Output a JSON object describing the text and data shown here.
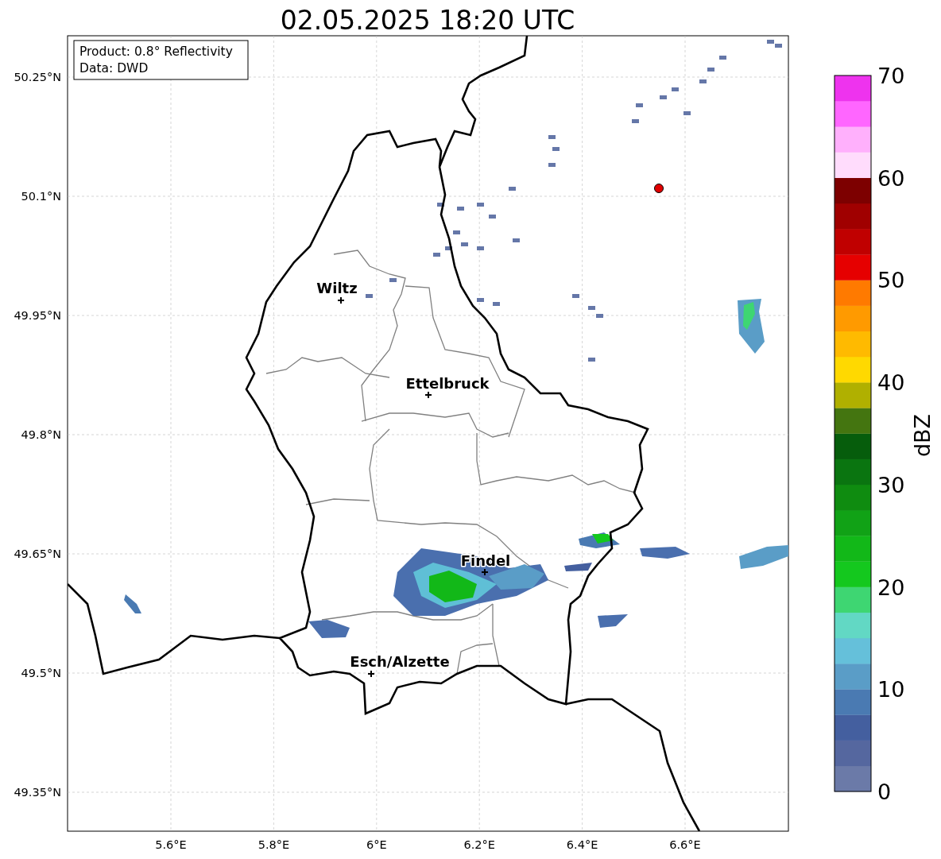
{
  "title": "02.05.2025 18:20 UTC",
  "info_box": [
    "Product: 0.8° Reflectivity",
    "Data: DWD"
  ],
  "lat_labels": [
    "50.25°N",
    "50.1°N",
    "49.95°N",
    "49.8°N",
    "49.65°N",
    "49.5°N",
    "49.35°N"
  ],
  "lon_labels": [
    "5.6°E",
    "5.8°E",
    "6°E",
    "6.2°E",
    "6.4°E",
    "6.6°E"
  ],
  "cities": [
    {
      "name": "Wiltz"
    },
    {
      "name": "Ettelbruck"
    },
    {
      "name": "Findel"
    },
    {
      "name": "Esch/Alzette"
    }
  ],
  "colorbar": {
    "label": "dBZ",
    "ticks": [
      "70",
      "60",
      "50",
      "40",
      "30",
      "20",
      "10",
      "0"
    ],
    "bins": [
      {
        "color": "#6b7aa8"
      },
      {
        "color": "#55679f"
      },
      {
        "color": "#445f9f"
      },
      {
        "color": "#4a7ab2"
      },
      {
        "color": "#5a9dc7"
      },
      {
        "color": "#65c0da"
      },
      {
        "color": "#62d8c4"
      },
      {
        "color": "#3ed672"
      },
      {
        "color": "#14c81e"
      },
      {
        "color": "#12b818"
      },
      {
        "color": "#11a216"
      },
      {
        "color": "#0f8c10"
      },
      {
        "color": "#0a7510"
      },
      {
        "color": "#065d0c"
      },
      {
        "color": "#447510"
      },
      {
        "color": "#b0b000"
      },
      {
        "color": "#ffd900"
      },
      {
        "color": "#ffba00"
      },
      {
        "color": "#ff9a00"
      },
      {
        "color": "#ff7a00"
      },
      {
        "color": "#e60000"
      },
      {
        "color": "#c00000"
      },
      {
        "color": "#a00000"
      },
      {
        "color": "#7d0000"
      },
      {
        "color": "#ffdcfc"
      },
      {
        "color": "#ffb0fc"
      },
      {
        "color": "#ff66ff"
      },
      {
        "color": "#ee33ee"
      }
    ]
  }
}
